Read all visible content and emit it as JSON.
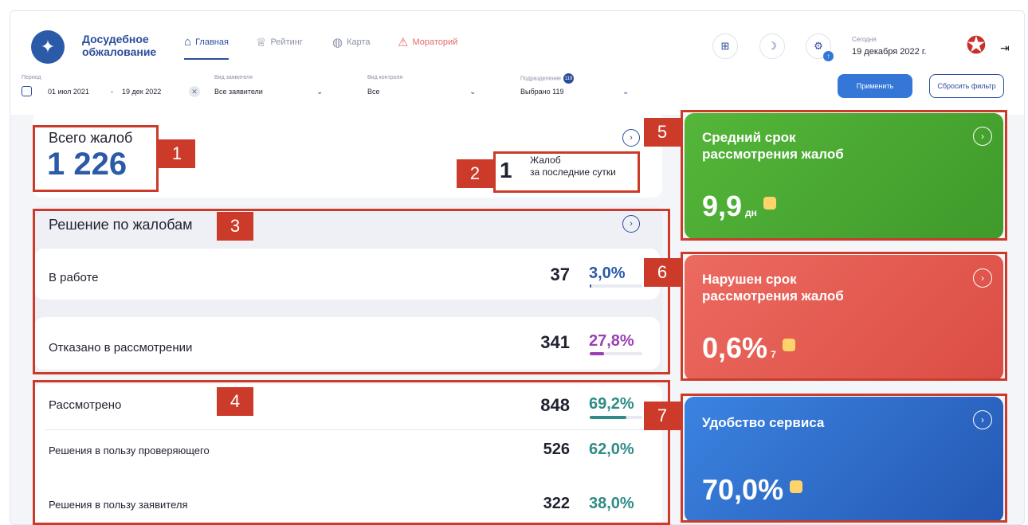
{
  "app": {
    "title_line1": "Досудебное",
    "title_line2": "обжалование"
  },
  "nav": {
    "home": "Главная",
    "rating": "Рейтинг",
    "map": "Карта",
    "moratorium": "Мораторий"
  },
  "header": {
    "today_label": "Сегодня",
    "today_value": "19 декабря 2022 г.",
    "notif_badge": "↑"
  },
  "filters": {
    "period_label": "Период",
    "period_from": "01 июл 2021",
    "period_sep": "-",
    "period_to": "19 дек 2022",
    "applicant_label": "Вид заявителя",
    "applicant_value": "Все заявители",
    "control_label": "Вид контроля",
    "control_value": "Все",
    "division_label": "Подразделение",
    "division_count": "119",
    "division_value": "Выбрано 119",
    "apply": "Применить",
    "reset": "Сбросить фильтр"
  },
  "total": {
    "label": "Всего жалоб",
    "value": "1 226",
    "last_day_value": "1",
    "last_day_line1": "Жалоб",
    "last_day_line2": "за последние сутки"
  },
  "decisions": {
    "title": "Решение по жалобам",
    "rows": [
      {
        "label": "В работе",
        "count": "37",
        "pct": "3,0%",
        "fill": 0.03,
        "color": "#2b5aa8"
      },
      {
        "label": "Отказано в рассмотрении",
        "count": "341",
        "pct": "27,8%",
        "fill": 0.278,
        "color": "#9b3fb5"
      }
    ]
  },
  "reviewed": {
    "label": "Рассмотрено",
    "count": "848",
    "pct": "69,2%",
    "fill": 0.692,
    "color": "#2f8b86",
    "rows": [
      {
        "label": "Решения в пользу проверяющего",
        "count": "526",
        "pct": "62,0%"
      },
      {
        "label": "Решения в пользу заявителя",
        "count": "322",
        "pct": "38,0%"
      }
    ]
  },
  "kpis": [
    {
      "title": "Средний срок рассмотрения жалоб",
      "value": "9,9",
      "unit": "дн"
    },
    {
      "title": "Нарушен срок рассмотрения жалоб",
      "value": "0,6%",
      "unit": "7"
    },
    {
      "title": "Удобство сервиса",
      "value": "70,0%",
      "unit": ""
    }
  ],
  "annotations": [
    "1",
    "2",
    "3",
    "4",
    "5",
    "6",
    "7"
  ],
  "colors": {
    "accent": "#2b4d9c",
    "kpi_green": "#44a630",
    "kpi_red": "#e6544c",
    "kpi_blue": "#2d6fd0",
    "annotation": "#cc3b2a"
  }
}
